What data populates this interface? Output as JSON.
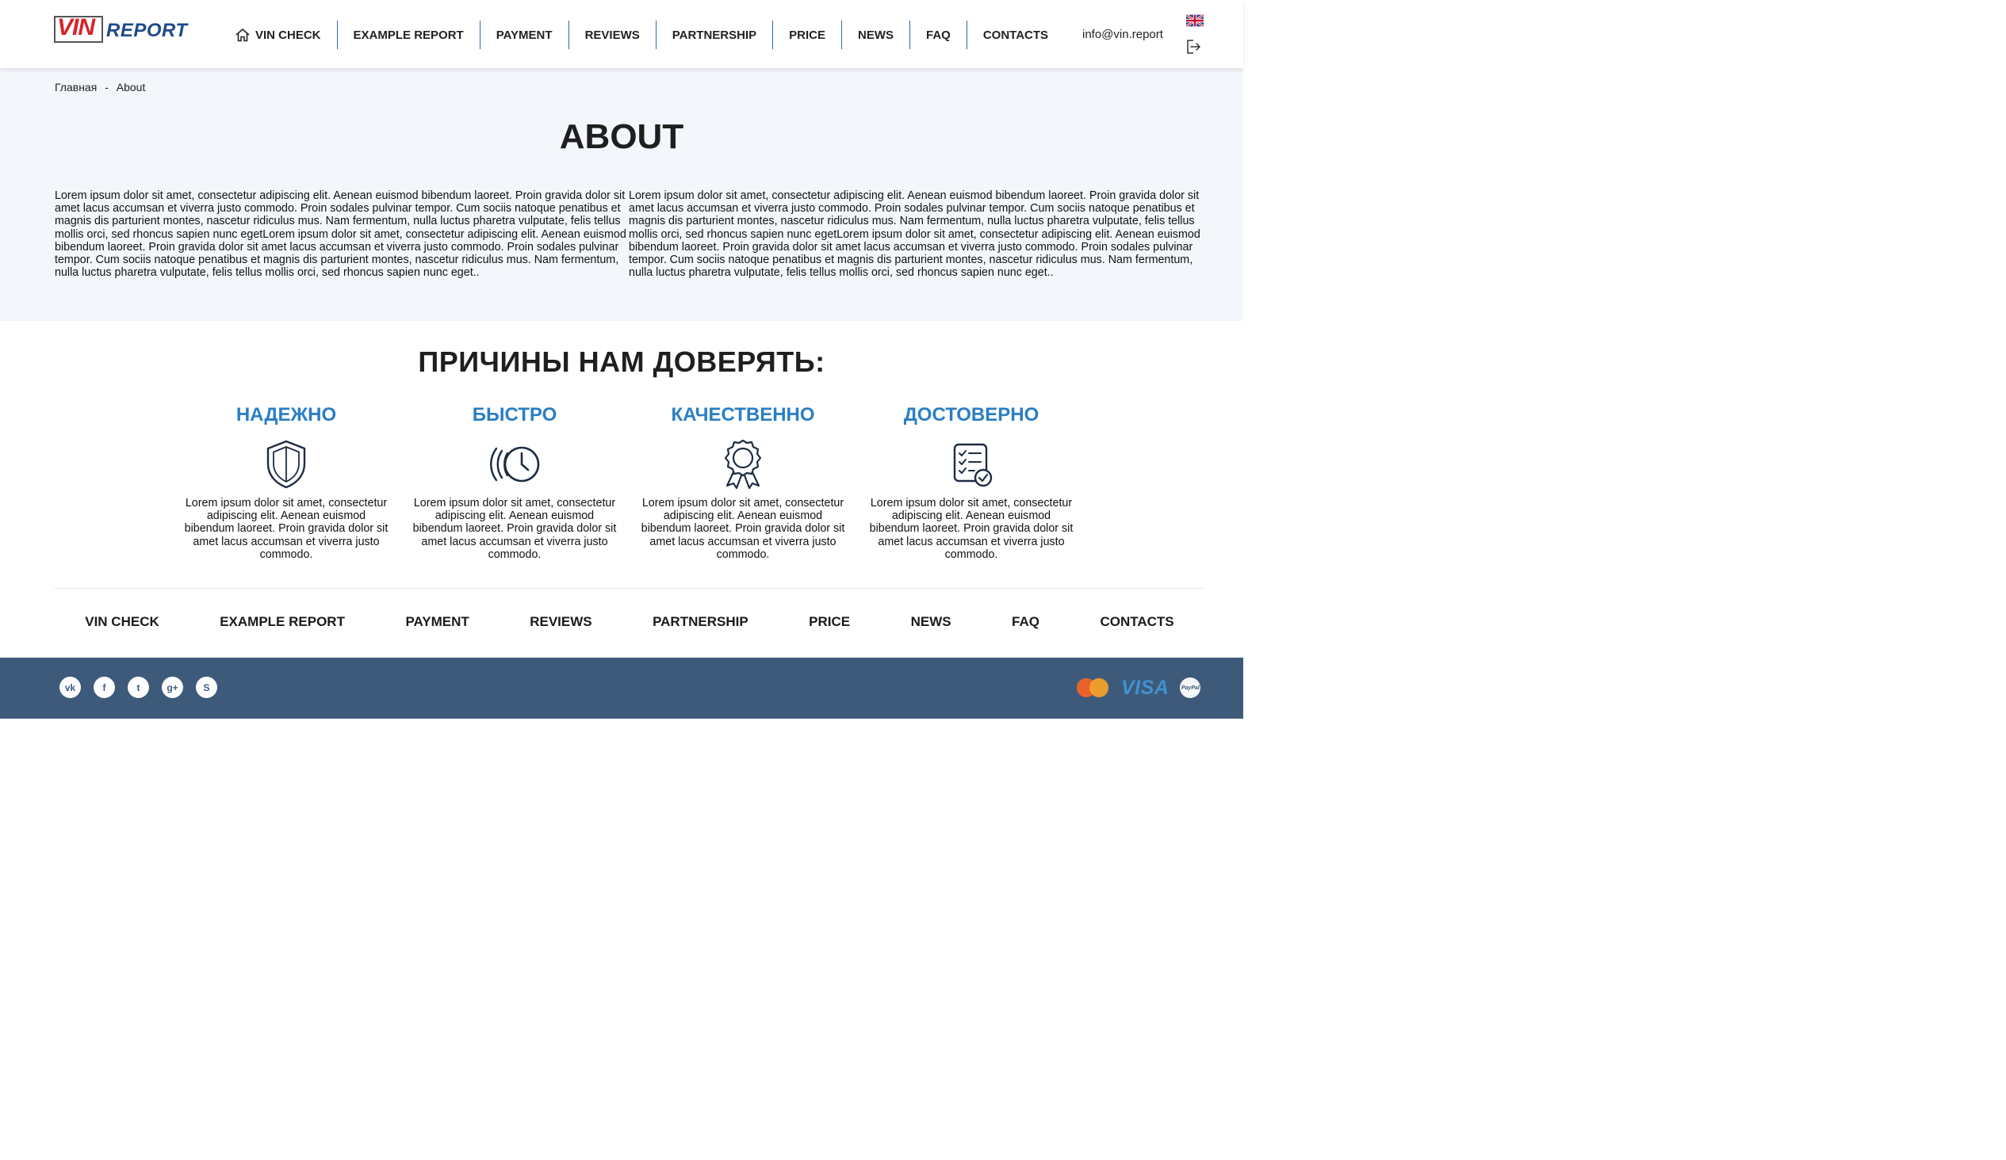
{
  "header": {
    "logo": {
      "vin": "VIN",
      "report": "REPORT"
    },
    "nav": [
      {
        "label": "VIN CHECK",
        "icon": "home-icon"
      },
      {
        "label": "EXAMPLE REPORT"
      },
      {
        "label": "PAYMENT"
      },
      {
        "label": "REVIEWS"
      },
      {
        "label": "PARTNERSHIP"
      },
      {
        "label": "PRICE"
      },
      {
        "label": "NEWS"
      },
      {
        "label": "FAQ"
      },
      {
        "label": "CONTACTS"
      }
    ],
    "email": "info@vin.report",
    "language_icon": "uk-flag-icon",
    "logout_icon": "logout-icon"
  },
  "breadcrumb": {
    "home": "Главная",
    "separator": "-",
    "current": "About"
  },
  "about": {
    "title": "ABOUT",
    "left_text": "Lorem ipsum dolor sit amet, consectetur adipiscing elit. Aenean euismod bibendum laoreet. Proin gravida dolor sit amet lacus accumsan et viverra justo commodo. Proin sodales pulvinar tempor. Cum sociis natoque penatibus et magnis dis parturient montes, nascetur ridiculus mus. Nam fermentum, nulla luctus pharetra vulputate, felis tellus mollis orci, sed rhoncus sapien nunc egetLorem ipsum dolor sit amet, consectetur adipiscing elit. Aenean euismod bibendum laoreet. Proin gravida dolor sit amet lacus accumsan et viverra justo commodo. Proin sodales pulvinar tempor. Cum sociis natoque penatibus et magnis dis parturient montes, nascetur ridiculus mus. Nam fermentum, nulla luctus pharetra vulputate, felis tellus mollis orci, sed rhoncus sapien nunc eget..",
    "right_text": "Lorem ipsum dolor sit amet, consectetur adipiscing elit. Aenean euismod bibendum laoreet. Proin gravida dolor sit amet lacus accumsan et viverra justo commodo. Proin sodales pulvinar tempor. Cum sociis natoque penatibus et magnis dis parturient montes, nascetur ridiculus mus. Nam fermentum, nulla luctus pharetra vulputate, felis tellus mollis orci, sed rhoncus sapien nunc egetLorem ipsum dolor sit amet, consectetur adipiscing elit. Aenean euismod bibendum laoreet. Proin gravida dolor sit amet lacus accumsan et viverra justo commodo. Proin sodales pulvinar tempor. Cum sociis natoque penatibus et magnis dis parturient montes, nascetur ridiculus mus. Nam fermentum, nulla luctus pharetra vulputate, felis tellus mollis orci, sed rhoncus sapien nunc eget.."
  },
  "trust": {
    "title": "ПРИЧИНЫ НАМ ДОВЕРЯТЬ:",
    "items": [
      {
        "title": "НАДЕЖНО",
        "icon": "shield-icon",
        "text": "Lorem ipsum dolor sit amet, consectetur adipiscing elit. Aenean euismod bibendum laoreet. Proin gravida dolor sit amet lacus accumsan et viverra justo commodo."
      },
      {
        "title": "БЫСТРО",
        "icon": "fast-clock-icon",
        "text": "Lorem ipsum dolor sit amet, consectetur adipiscing elit. Aenean euismod bibendum laoreet. Proin gravida dolor sit amet lacus accumsan et viverra justo commodo."
      },
      {
        "title": "КАЧЕСТВЕННО",
        "icon": "award-ribbon-icon",
        "text": "Lorem ipsum dolor sit amet, consectetur adipiscing elit. Aenean euismod bibendum laoreet. Proin gravida dolor sit amet lacus accumsan et viverra justo commodo."
      },
      {
        "title": "ДОСТОВЕРНО",
        "icon": "checklist-icon",
        "text": "Lorem ipsum dolor sit amet, consectetur adipiscing elit. Aenean euismod bibendum laoreet. Proin gravida dolor sit amet lacus accumsan et viverra justo commodo."
      }
    ]
  },
  "footer_nav": [
    "VIN CHECK",
    "EXAMPLE REPORT",
    "PAYMENT",
    "REVIEWS",
    "PARTNERSHIP",
    "PRICE",
    "NEWS",
    "FAQ",
    "CONTACTS"
  ],
  "bottom": {
    "social": [
      {
        "icon": "vk-icon",
        "glyph": "vk"
      },
      {
        "icon": "facebook-icon",
        "glyph": "f"
      },
      {
        "icon": "twitter-icon",
        "glyph": "t"
      },
      {
        "icon": "google-plus-icon",
        "glyph": "g+"
      },
      {
        "icon": "skype-icon",
        "glyph": "S"
      }
    ],
    "payments": {
      "visa": "VISA",
      "paypal": "PayPal"
    },
    "colors": {
      "bar": "#3e5a7b",
      "accent": "#2a7ec4",
      "brand_red": "#d8232a",
      "brand_blue": "#1f4a8c"
    }
  }
}
